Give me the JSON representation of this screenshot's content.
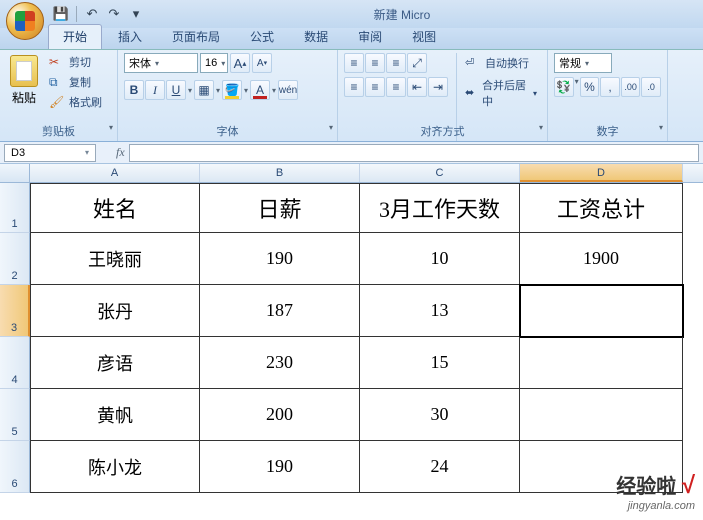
{
  "app_title": "新建 Micro",
  "qat": {
    "save": "💾",
    "undo": "↶",
    "redo": "↷"
  },
  "tabs": [
    "开始",
    "插入",
    "页面布局",
    "公式",
    "数据",
    "审阅",
    "视图"
  ],
  "active_tab": 0,
  "ribbon": {
    "clipboard": {
      "label": "剪贴板",
      "paste": "粘贴",
      "cut": "剪切",
      "copy": "复制",
      "format_painter": "格式刷"
    },
    "font": {
      "label": "字体",
      "name": "宋体",
      "size": "16",
      "grow": "A",
      "shrink": "A",
      "bold": "B",
      "italic": "I",
      "underline": "U"
    },
    "alignment": {
      "label": "对齐方式",
      "wrap": "自动换行",
      "merge": "合并后居中"
    },
    "number": {
      "label": "数字",
      "format": "常规"
    }
  },
  "namebox": "D3",
  "fx": "fx",
  "columns": [
    "A",
    "B",
    "C",
    "D"
  ],
  "rows": [
    "1",
    "2",
    "3",
    "4",
    "5",
    "6"
  ],
  "active_cell": {
    "row": 2,
    "col": 3
  },
  "headers": [
    "姓名",
    "日薪",
    "3月工作天数",
    "工资总计"
  ],
  "data": [
    [
      "王晓丽",
      "190",
      "10",
      "1900"
    ],
    [
      "张丹",
      "187",
      "13",
      ""
    ],
    [
      "彦语",
      "230",
      "15",
      ""
    ],
    [
      "黄帆",
      "200",
      "30",
      ""
    ],
    [
      "陈小龙",
      "190",
      "24",
      ""
    ]
  ],
  "watermark": {
    "text": "经验啦",
    "check": "√",
    "url": "jingyanla.com"
  }
}
